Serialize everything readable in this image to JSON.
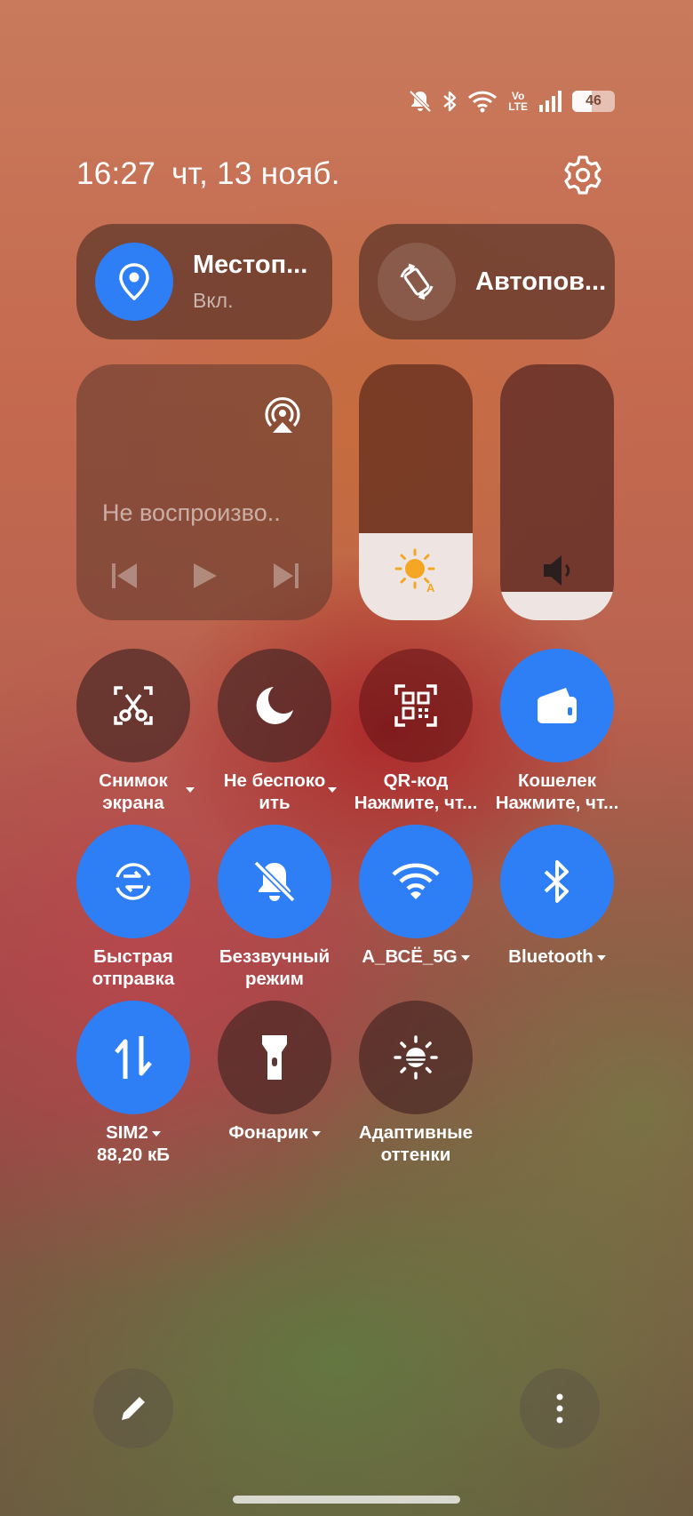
{
  "status_bar": {
    "icons": [
      "bell-off-icon",
      "bluetooth-icon",
      "wifi-icon",
      "volte-icon",
      "signal-icon",
      "battery-icon"
    ],
    "volte_top": "Vo",
    "volte_bottom": "LTE",
    "battery": "46"
  },
  "header": {
    "time": "16:27",
    "date": "чт, 13 нояб."
  },
  "tiles": {
    "location": {
      "label": "Местоп...",
      "status": "Вкл.",
      "active": true
    },
    "autorotate": {
      "label": "Автопов...",
      "active": false
    }
  },
  "media": {
    "now_playing": "Не воспроизво..",
    "controls": [
      "previous-icon",
      "play-icon",
      "next-icon"
    ],
    "cast_icon": "cast-icon"
  },
  "sliders": {
    "brightness": {
      "icon": "auto-brightness-icon",
      "level": 0.34
    },
    "volume": {
      "icon": "speaker-icon",
      "level": 0.11
    }
  },
  "toggles": [
    {
      "id": "screenshot",
      "icon": "scissors-icon",
      "line1": "Снимок",
      "line2": "экрана",
      "active": false,
      "menu": true
    },
    {
      "id": "dnd",
      "icon": "moon-icon",
      "line1": "Не беспоко",
      "line2": "ить",
      "active": false,
      "menu": true
    },
    {
      "id": "qr",
      "icon": "qr-code-icon",
      "line1": "QR-код",
      "line2": "Нажмите, чт...",
      "active": false
    },
    {
      "id": "wallet",
      "icon": "wallet-icon",
      "line1": "Кошелек",
      "line2": "Нажмите, чт...",
      "active": true
    },
    {
      "id": "quickshare",
      "icon": "quick-share-icon",
      "line1": "Быстрая",
      "line2": "отправка",
      "active": true
    },
    {
      "id": "silent",
      "icon": "bell-off-icon",
      "line1": "Беззвучный",
      "line2": "режим",
      "active": true
    },
    {
      "id": "wifi",
      "icon": "wifi-icon",
      "line1": "A_ВСЁ_5G",
      "active": true,
      "menu": true
    },
    {
      "id": "bluetooth",
      "icon": "bluetooth-icon",
      "line1": "Bluetooth",
      "active": true,
      "menu": true
    },
    {
      "id": "sim",
      "icon": "mobile-data-icon",
      "line1": "SIM2",
      "line2": "88,20 кБ",
      "active": true,
      "menu": true
    },
    {
      "id": "flashlight",
      "icon": "flashlight-icon",
      "line1": "Фонарик",
      "active": false,
      "menu": true
    },
    {
      "id": "adaptive",
      "icon": "adaptive-tone-icon",
      "line1": "Адаптивные",
      "line2": "оттенки",
      "active": false
    }
  ],
  "bottom": {
    "edit_icon": "pencil-icon",
    "more_icon": "more-vertical-icon"
  },
  "colors": {
    "accent": "#2e7ff6",
    "tile_dark": "#5c3428",
    "brightness_sun": "#f5a623"
  }
}
